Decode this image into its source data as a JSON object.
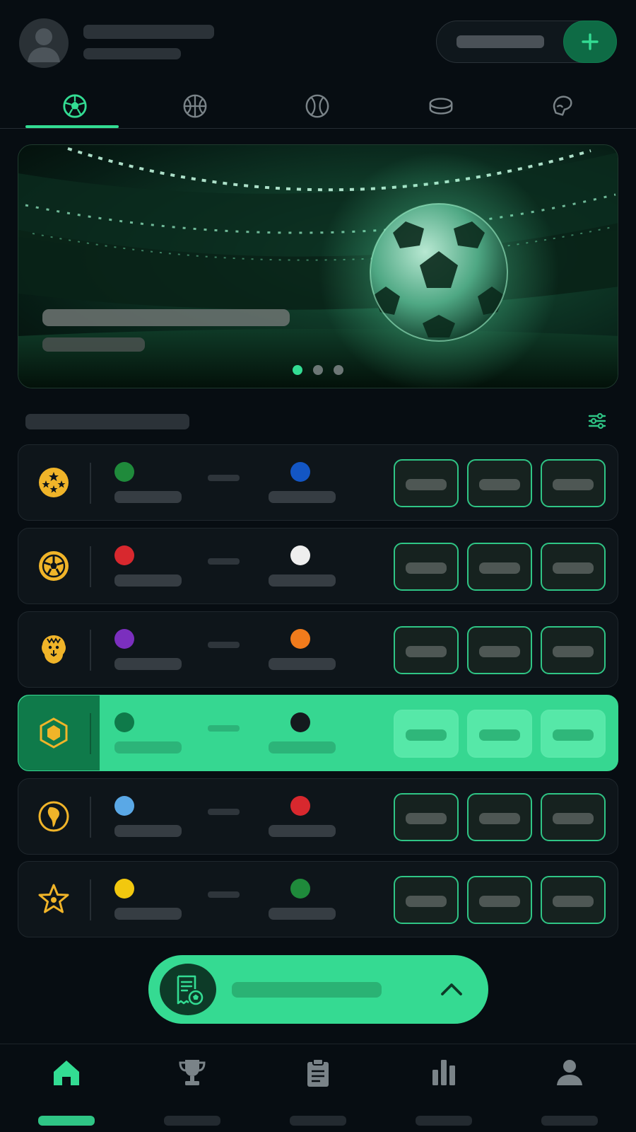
{
  "colors": {
    "accent": "#33dc93",
    "accent_dark": "#0e6b45",
    "background": "#070d12",
    "card": "#0e151a",
    "league_gold": "#f0b429"
  },
  "header": {
    "avatar_icon": "user-avatar-icon",
    "add_icon": "plus-icon"
  },
  "sport_tabs": [
    {
      "icon": "soccer-ball-icon",
      "active": true
    },
    {
      "icon": "basketball-icon",
      "active": false
    },
    {
      "icon": "tennis-ball-icon",
      "active": false
    },
    {
      "icon": "hockey-puck-icon",
      "active": false
    },
    {
      "icon": "boxing-glove-icon",
      "active": false
    }
  ],
  "banner": {
    "image": "stadium-soccer-ball-image",
    "carousel_pages": 3,
    "active_page": 1
  },
  "section": {
    "filter_icon": "sliders-icon"
  },
  "matches": [
    {
      "league_icon": "champions-league-icon",
      "home_color": "#1f8a3b",
      "away_color": "#1356c4",
      "highlighted": false
    },
    {
      "league_icon": "europa-league-icon",
      "home_color": "#d8282e",
      "away_color": "#eeeeee",
      "highlighted": false
    },
    {
      "league_icon": "premier-league-lion-icon",
      "home_color": "#7b2fbe",
      "away_color": "#f07b1c",
      "highlighted": false
    },
    {
      "league_icon": "hexagon-league-icon",
      "home_color": "#0f7a4a",
      "away_color": "#141a1e",
      "highlighted": true
    },
    {
      "league_icon": "south-america-league-icon",
      "home_color": "#5aa8e6",
      "away_color": "#d8282e",
      "highlighted": false
    },
    {
      "league_icon": "star-league-icon",
      "home_color": "#f2c80f",
      "away_color": "#1f8a3b",
      "highlighted": false
    }
  ],
  "bet_slip": {
    "icon": "bet-slip-receipt-icon",
    "expand_icon": "chevron-up-icon"
  },
  "bottom_nav": [
    {
      "icon": "home-icon",
      "active": true
    },
    {
      "icon": "trophy-icon",
      "active": false
    },
    {
      "icon": "clipboard-icon",
      "active": false
    },
    {
      "icon": "bar-chart-icon",
      "active": false
    },
    {
      "icon": "profile-icon",
      "active": false
    }
  ]
}
